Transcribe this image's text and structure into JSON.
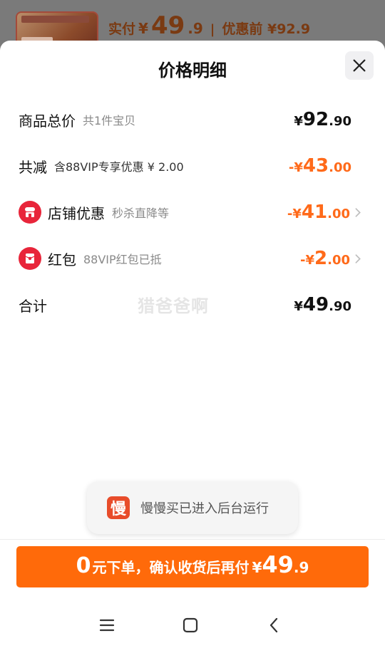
{
  "background": {
    "paid_label": "实付",
    "currency": "¥",
    "paid_int": "49",
    "paid_dec": ".9",
    "separator": "|",
    "before_label": "优惠前 ¥92.9"
  },
  "sheet": {
    "title": "价格明细",
    "close_icon": "close-icon"
  },
  "rows": {
    "total": {
      "label": "商品总价",
      "sub": "共1件宝贝",
      "yen": "¥",
      "int": "92",
      "dec": ".90"
    },
    "reduce": {
      "label": "共减",
      "sub": "含88VIP专享优惠 ¥ 2.00",
      "yen": "-¥",
      "int": "43",
      "dec": ".00"
    },
    "shop": {
      "label": "店铺优惠",
      "sub": "秒杀直降等",
      "yen": "-¥",
      "int": "41",
      "dec": ".00",
      "icon": "shop-icon"
    },
    "redpacket": {
      "label": "红包",
      "sub": "88VIP红包已抵",
      "yen": "-¥",
      "int": "2",
      "dec": ".00",
      "icon": "red-packet-icon"
    },
    "sum": {
      "label": "合计",
      "yen": "¥",
      "int": "49",
      "dec": ".90"
    }
  },
  "watermark": "猎爸爸啊",
  "toast": {
    "icon_char": "慢",
    "text": "慢慢买已进入后台运行"
  },
  "cta": {
    "zero": "0",
    "text": "元下单，确认收货后再付",
    "yen": "¥",
    "int": "49",
    "dec": ".9"
  },
  "colors": {
    "accent_orange": "#ff6a0a",
    "discount_orange": "#ff6a1a",
    "icon_red": "#e8253a"
  }
}
